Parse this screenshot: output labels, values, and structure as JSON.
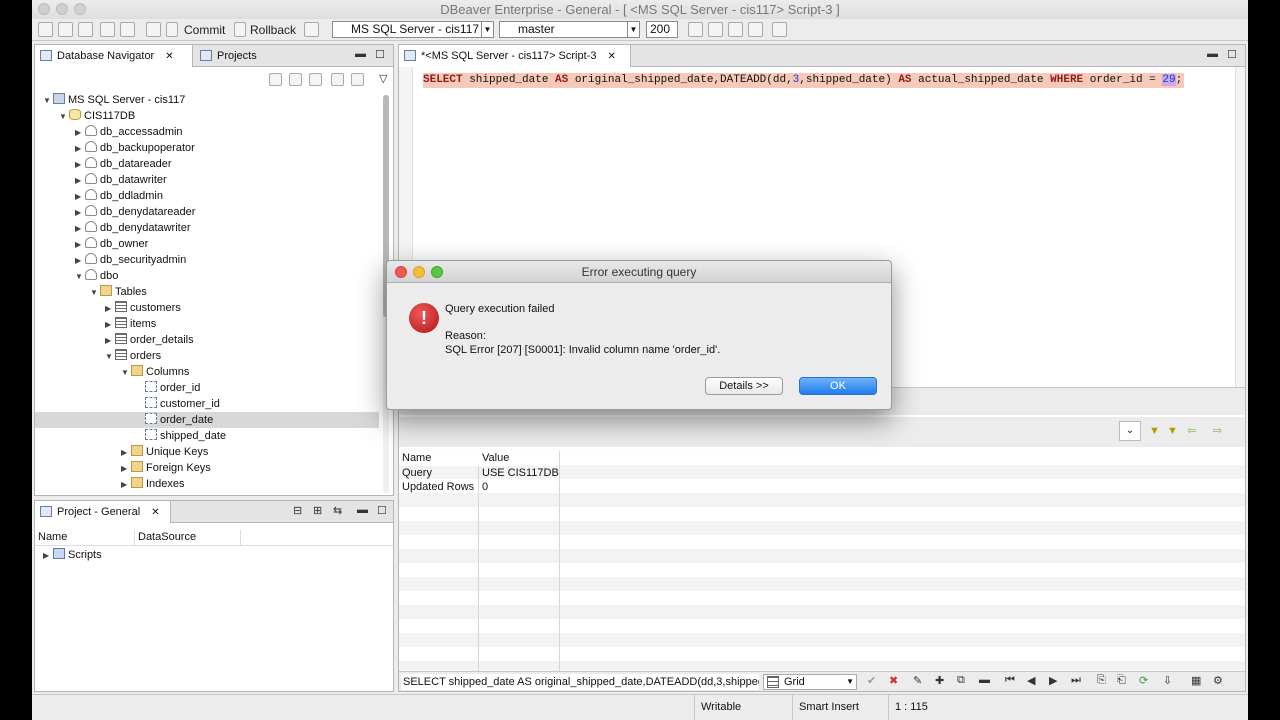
{
  "window": {
    "title": "DBeaver Enterprise - General - [ <MS SQL Server - cis117> Script-3 ]"
  },
  "toolbar": {
    "commit_label": "Commit",
    "rollback_label": "Rollback",
    "connection": "MS SQL Server - cis117",
    "database": "master",
    "max_rows": "200"
  },
  "navigator": {
    "tab_label": "Database Navigator",
    "projects_tab_label": "Projects",
    "tree": {
      "server": "MS SQL Server - cis117",
      "database": "CIS117DB",
      "roles": [
        "db_accessadmin",
        "db_backupoperator",
        "db_datareader",
        "db_datawriter",
        "db_ddladmin",
        "db_denydatareader",
        "db_denydatawriter",
        "db_owner",
        "db_securityadmin"
      ],
      "schema": "dbo",
      "tables_folder": "Tables",
      "tables": [
        "customers",
        "items",
        "order_details",
        "orders"
      ],
      "columns_folder": "Columns",
      "columns": [
        "order_id",
        "customer_id",
        "order_date",
        "shipped_date"
      ],
      "unique_keys": "Unique Keys",
      "foreign_keys": "Foreign Keys",
      "indexes": "Indexes"
    }
  },
  "project": {
    "tab_label": "Project - General",
    "col_name": "Name",
    "col_datasource": "DataSource",
    "scripts_label": "Scripts"
  },
  "editor": {
    "tab_label": "*<MS SQL Server - cis117> Script-3",
    "sql": {
      "kw_select": "SELECT",
      "part1": " shipped_date ",
      "kw_as1": "AS",
      "part2": " original_shipped_date,DATEADD(dd,",
      "num_3": "3",
      "part3": ",shipped_date) ",
      "kw_as2": "AS",
      "part4": " actual_shipped_date ",
      "kw_where": "WHERE",
      "part5": " order_id = ",
      "num_29": "29",
      "part6": ";"
    }
  },
  "results": {
    "headers": [
      "Name",
      "Value"
    ],
    "rows": [
      [
        "Query",
        "USE CIS117DB"
      ],
      [
        "Updated Rows",
        "0"
      ]
    ],
    "query_text": "SELECT shipped_date AS original_shipped_date,DATEADD(dd,3,shipped_",
    "view_mode": "Grid"
  },
  "status": {
    "writable": "Writable",
    "insert_mode": "Smart Insert",
    "position": "1 : 115"
  },
  "dialog": {
    "title": "Error executing query",
    "message": "Query execution failed",
    "reason_label": "Reason:",
    "reason": "SQL Error [207] [S0001]: Invalid column name 'order_id'.",
    "details_button": "Details >>",
    "ok_button": "OK"
  },
  "colors": {
    "sql_highlight": "#f6c9b8",
    "keyword": "#8b1e1e",
    "number": "#1a3ad3",
    "ok_button": "#1f7cef",
    "error_icon": "#c41818"
  }
}
